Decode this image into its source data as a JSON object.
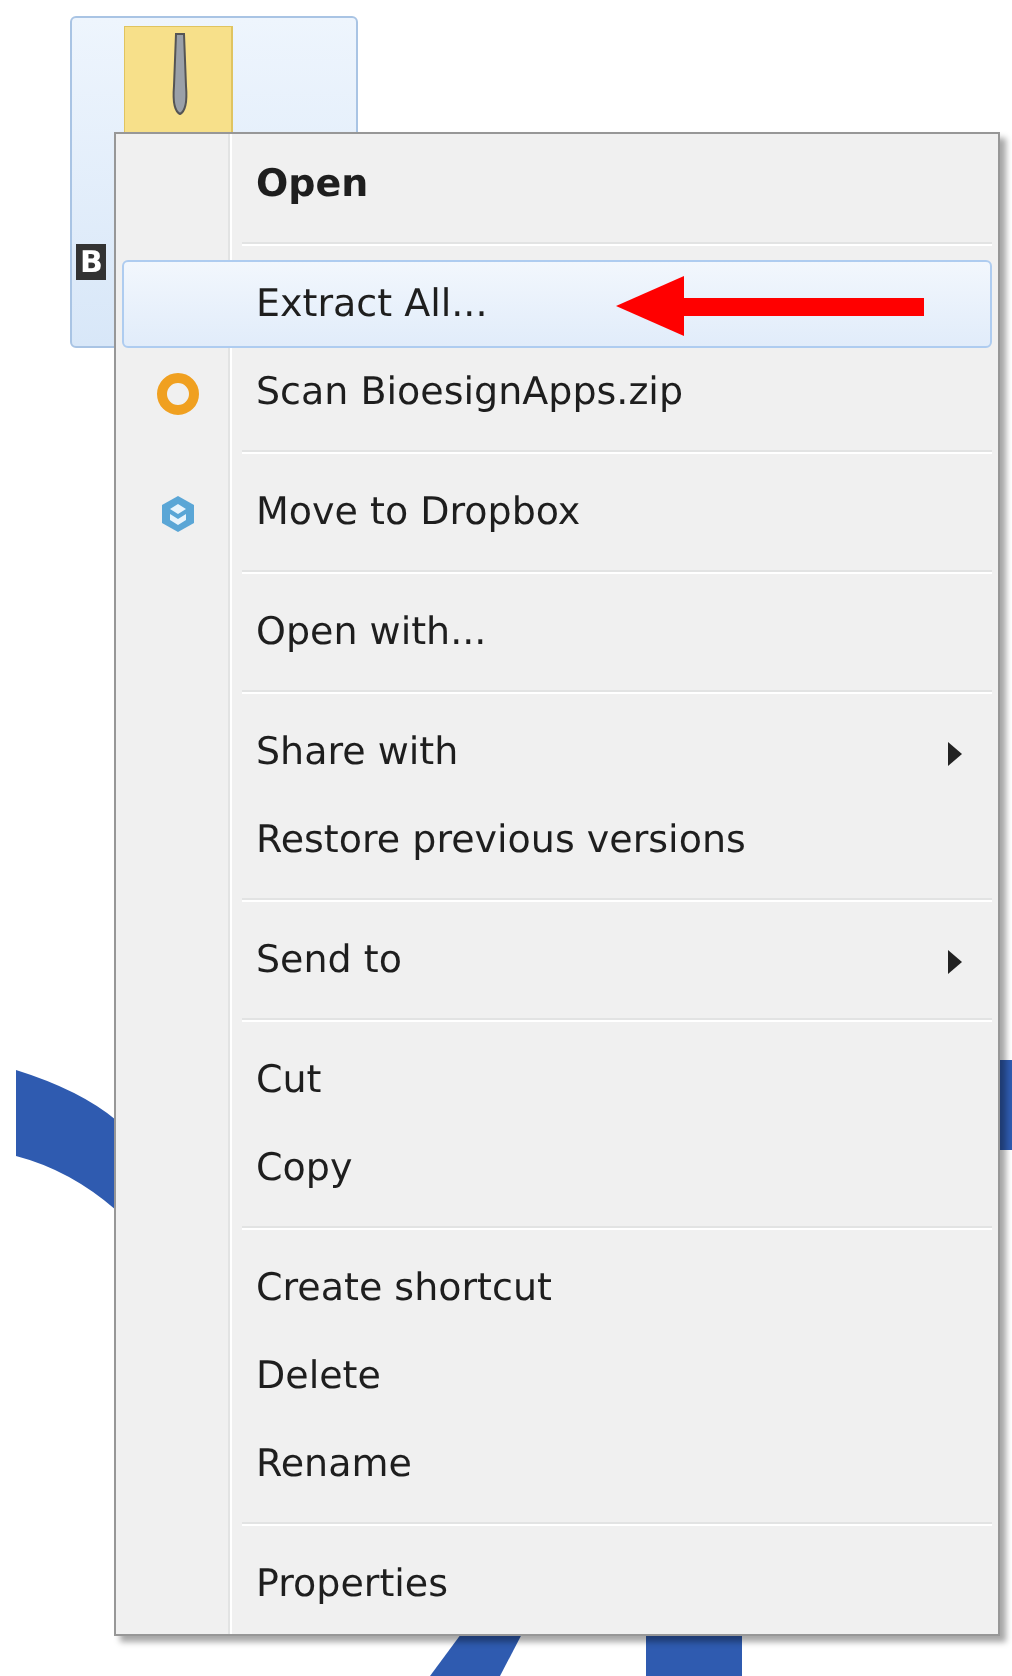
{
  "desktop_icon": {
    "label": "B",
    "selected": true
  },
  "context_menu": {
    "groups": [
      {
        "items": [
          {
            "label": "Open",
            "default": true,
            "selected": false,
            "submenu": false,
            "kind": "plain"
          }
        ]
      },
      {
        "items": [
          {
            "label": "Extract All...",
            "default": false,
            "selected": true,
            "submenu": false,
            "kind": "plain"
          },
          {
            "label": "Scan BioesignApps.zip",
            "default": false,
            "selected": false,
            "submenu": false,
            "kind": "ring"
          }
        ]
      },
      {
        "items": [
          {
            "label": "Move to Dropbox",
            "default": false,
            "selected": false,
            "submenu": false,
            "kind": "cube"
          }
        ]
      },
      {
        "items": [
          {
            "label": "Open with...",
            "default": false,
            "selected": false,
            "submenu": false,
            "kind": "plain"
          }
        ]
      },
      {
        "items": [
          {
            "label": "Share with",
            "default": false,
            "selected": false,
            "submenu": true,
            "kind": "plain"
          },
          {
            "label": "Restore previous versions",
            "default": false,
            "selected": false,
            "submenu": false,
            "kind": "plain"
          }
        ]
      },
      {
        "items": [
          {
            "label": "Send to",
            "default": false,
            "selected": false,
            "submenu": true,
            "kind": "plain"
          }
        ]
      },
      {
        "items": [
          {
            "label": "Cut",
            "default": false,
            "selected": false,
            "submenu": false,
            "kind": "plain"
          },
          {
            "label": "Copy",
            "default": false,
            "selected": false,
            "submenu": false,
            "kind": "plain"
          }
        ]
      },
      {
        "items": [
          {
            "label": "Create shortcut",
            "default": false,
            "selected": false,
            "submenu": false,
            "kind": "plain"
          },
          {
            "label": "Delete",
            "default": false,
            "selected": false,
            "submenu": false,
            "kind": "plain"
          },
          {
            "label": "Rename",
            "default": false,
            "selected": false,
            "submenu": false,
            "kind": "plain"
          }
        ]
      },
      {
        "items": [
          {
            "label": "Properties",
            "default": false,
            "selected": false,
            "submenu": false,
            "kind": "plain"
          }
        ]
      }
    ]
  }
}
